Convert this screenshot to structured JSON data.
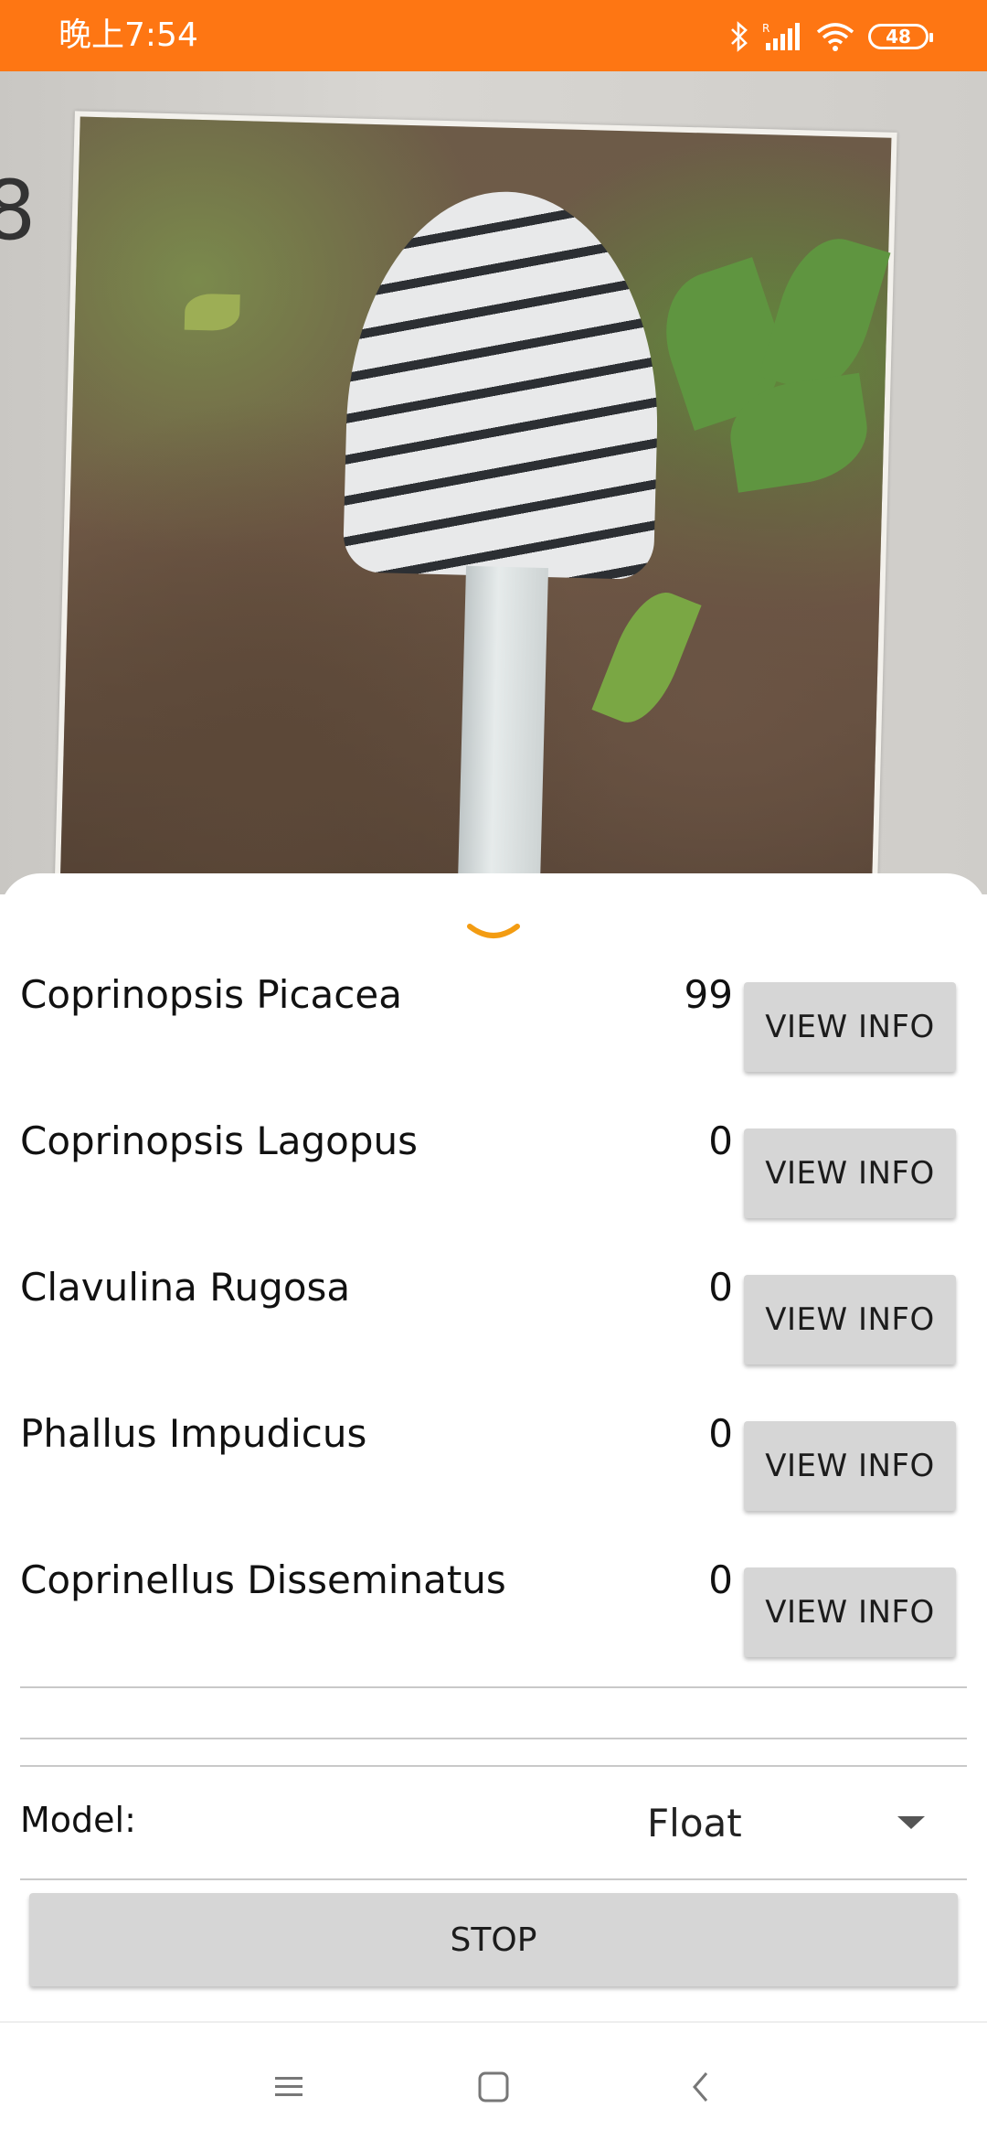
{
  "status_bar": {
    "time": "晚上7:54",
    "battery": "48",
    "icons": [
      "bluetooth-icon",
      "signal-icon",
      "wifi-icon",
      "battery-icon"
    ],
    "color": "#fe7613"
  },
  "camera": {
    "edge_text": "8"
  },
  "results": [
    {
      "name": "Coprinopsis Picacea",
      "score": "99",
      "button": "VIEW INFO"
    },
    {
      "name": "Coprinopsis Lagopus",
      "score": "0",
      "button": "VIEW INFO"
    },
    {
      "name": "Clavulina Rugosa",
      "score": "0",
      "button": "VIEW INFO"
    },
    {
      "name": "Phallus Impudicus",
      "score": "0",
      "button": "VIEW INFO"
    },
    {
      "name": "Coprinellus Disseminatus",
      "score": "0",
      "button": "VIEW INFO"
    }
  ],
  "model": {
    "label": "Model:",
    "value": "Float"
  },
  "stop_button": "STOP",
  "accent_color": "#f39c12",
  "nav": [
    "menu-icon",
    "home-icon",
    "back-icon"
  ]
}
